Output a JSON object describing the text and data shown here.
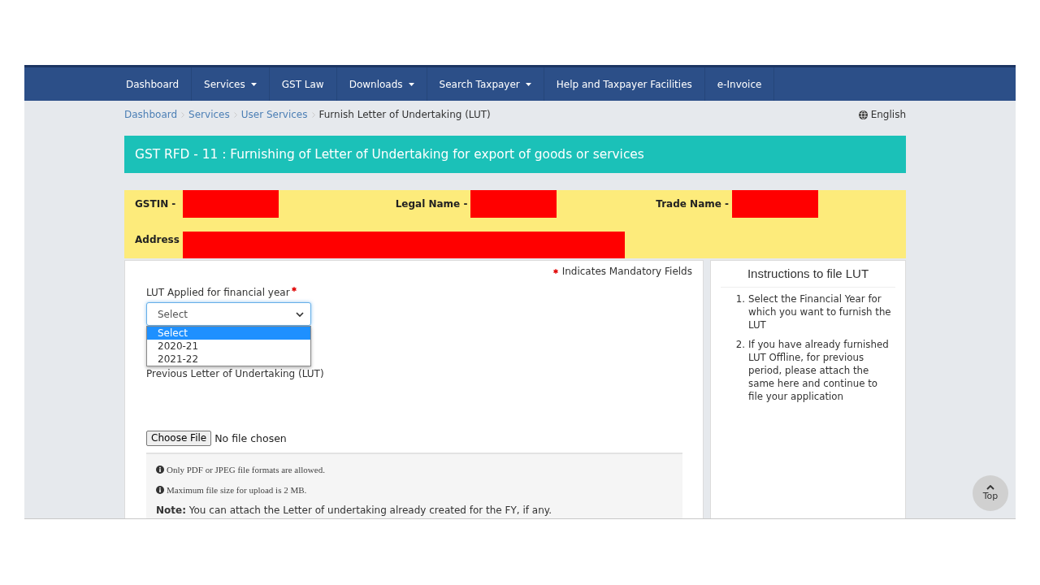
{
  "nav": [
    {
      "label": "Dashboard",
      "dropdown": false
    },
    {
      "label": "Services",
      "dropdown": true
    },
    {
      "label": "GST Law",
      "dropdown": false
    },
    {
      "label": "Downloads",
      "dropdown": true
    },
    {
      "label": "Search Taxpayer",
      "dropdown": true
    },
    {
      "label": "Help and Taxpayer Facilities",
      "dropdown": false
    },
    {
      "label": "e-Invoice",
      "dropdown": false
    }
  ],
  "breadcrumb": [
    {
      "label": "Dashboard",
      "link": true
    },
    {
      "label": "Services",
      "link": true
    },
    {
      "label": "User Services",
      "link": true
    },
    {
      "label": "Furnish Letter of Undertaking (LUT)",
      "link": false
    }
  ],
  "language": "English",
  "page_title": "GST RFD - 11 : Furnishing of Letter of Undertaking for export of goods or services",
  "taxpayer_details": {
    "rows": [
      {
        "fields": [
          {
            "label": "GSTIN -",
            "redacted": true
          },
          {
            "label": "Legal Name -",
            "redacted": true
          },
          {
            "label": "Trade Name -",
            "redacted": true
          }
        ]
      },
      {
        "fields": [
          {
            "label": "Address",
            "redacted": true
          }
        ]
      }
    ]
  },
  "form": {
    "mandatory_note": "Indicates Mandatory Fields",
    "financial_year": {
      "label": "LUT Applied for financial year",
      "required": true,
      "value": "Select",
      "expanded": true,
      "options": [
        {
          "label": "Select",
          "selected": true
        },
        {
          "label": "2020-21",
          "selected": false
        },
        {
          "label": "2021-22",
          "selected": false
        }
      ]
    },
    "previous_lut": {
      "label": "Previous Letter of Undertaking (LUT)",
      "button": "Choose File",
      "file_status": "No file chosen"
    },
    "upload_notes": [
      {
        "kind": "info",
        "text": "Only PDF or JPEG file formats are allowed."
      },
      {
        "kind": "info",
        "text": "Maximum file size for upload is 2 MB."
      },
      {
        "kind": "note",
        "text": "**Note:** You can attach the Letter of undertaking already created for the FY, if any."
      }
    ]
  },
  "instructions": {
    "title": "Instructions to file LUT",
    "steps": [
      {
        "number": "1.",
        "text": "Select the Financial Year for which you want to furnish the LUT"
      },
      {
        "number": "2.",
        "text": "If you have already furnished LUT Offline, for previous period, please attach the same here and continue to file your application"
      }
    ]
  },
  "top_button": "Top"
}
